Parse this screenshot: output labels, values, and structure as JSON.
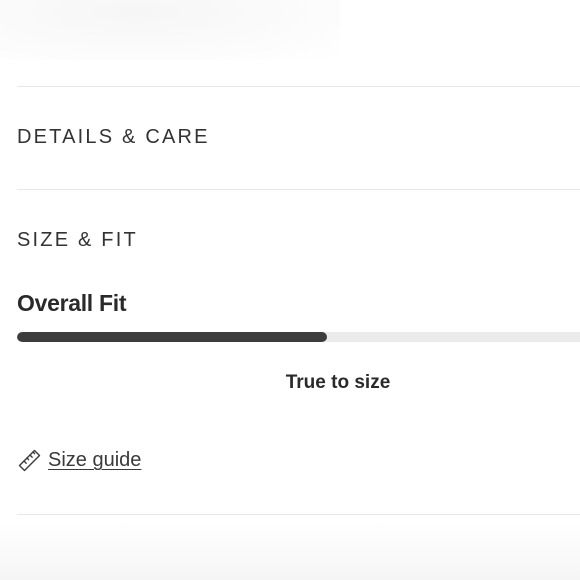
{
  "accordion": {
    "details_care": {
      "label": "DETAILS & CARE"
    },
    "size_fit": {
      "label": "SIZE & FIT"
    }
  },
  "fit": {
    "title": "Overall Fit",
    "result_label": "True to size",
    "level": 0.55,
    "track_color": "#ebebeb",
    "fill_color": "#3d3d3d"
  },
  "size_guide": {
    "label": "Size guide",
    "icon": "ruler-icon"
  }
}
